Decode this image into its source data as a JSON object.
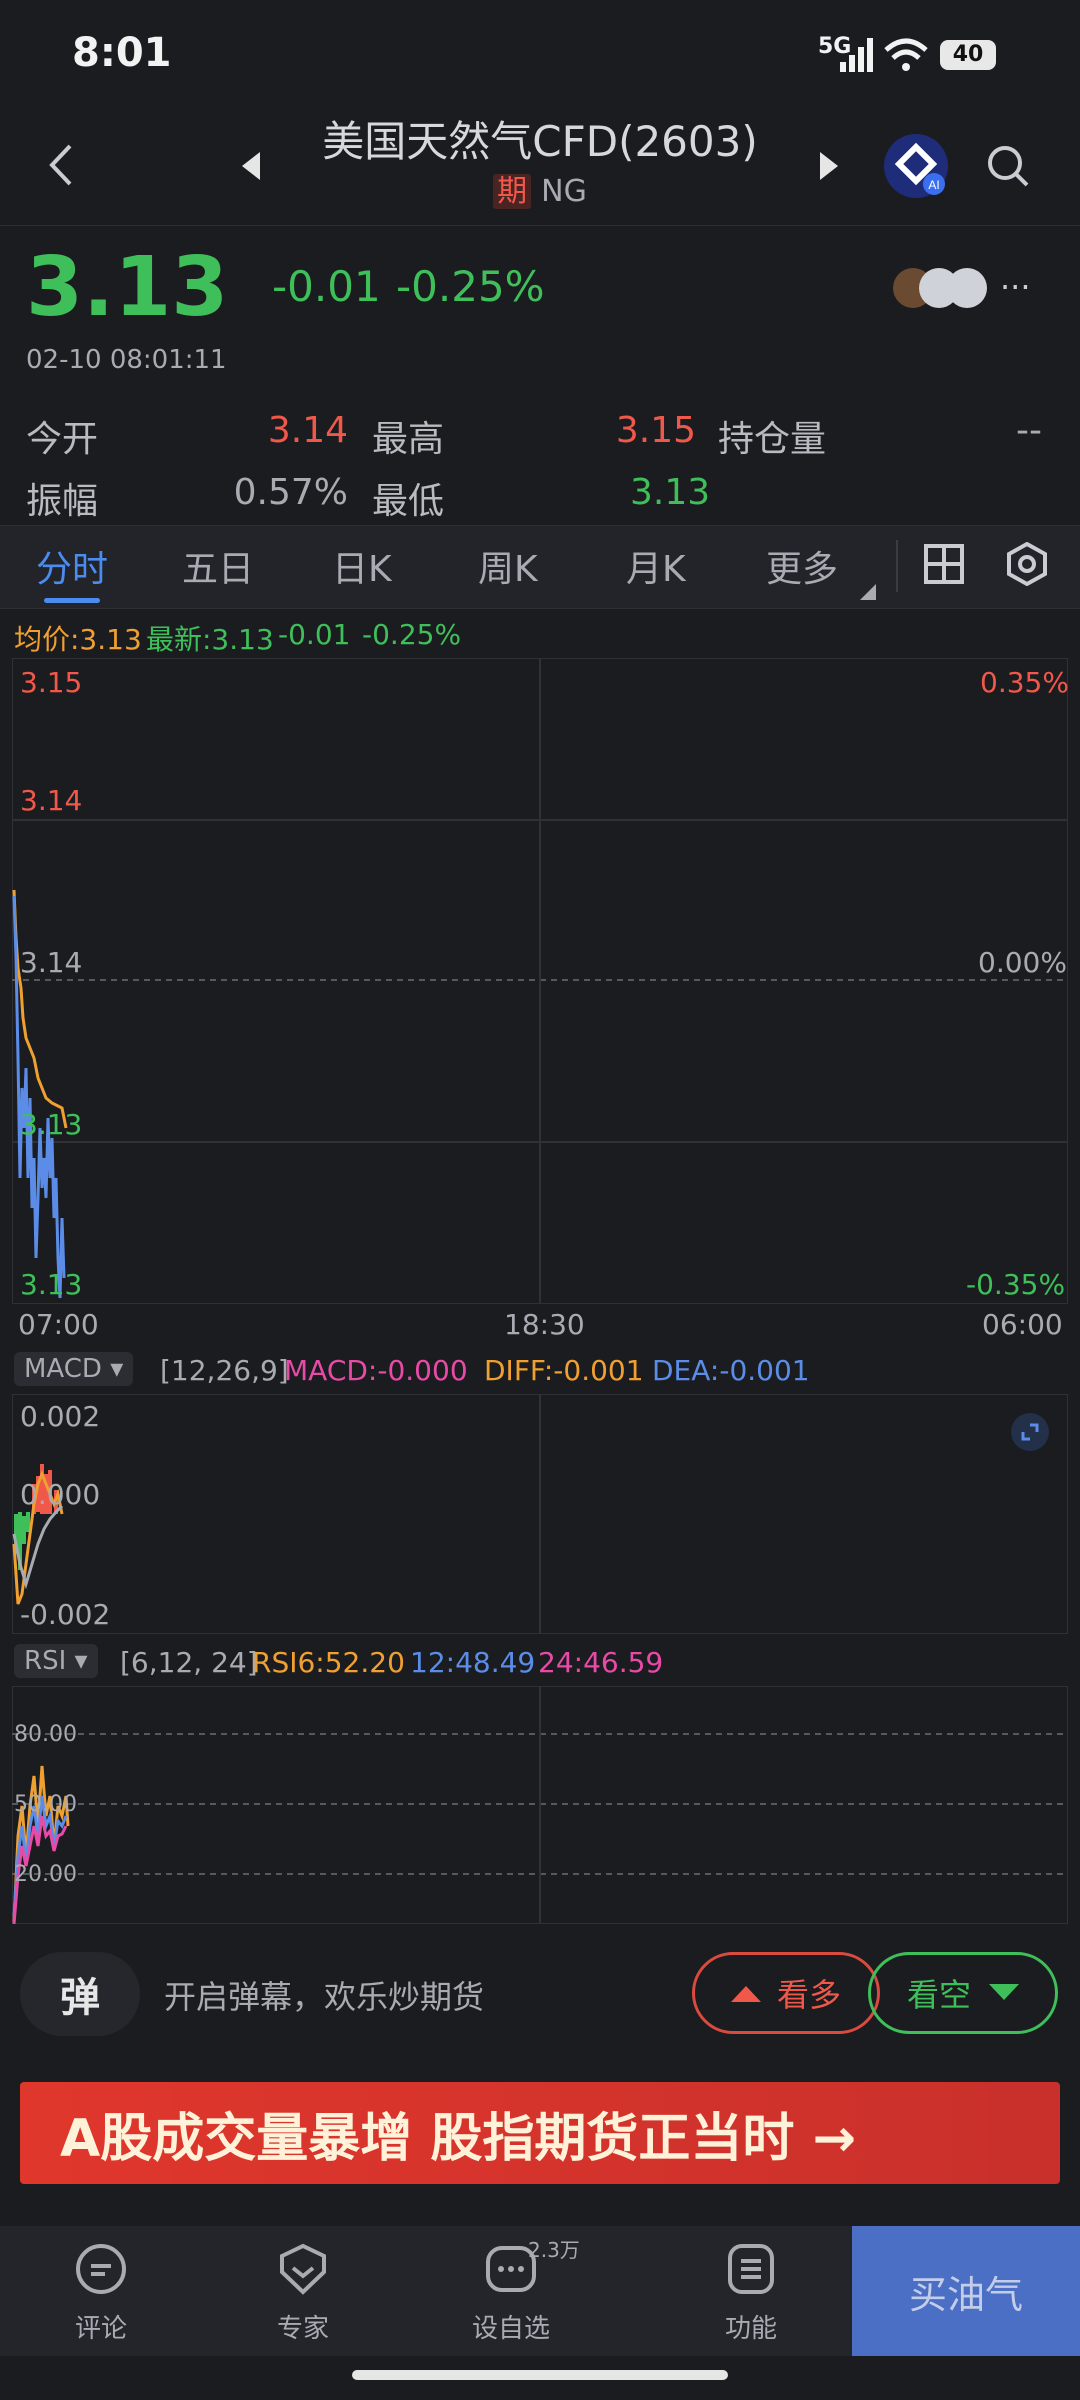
{
  "status": {
    "time": "8:01",
    "network": "5G",
    "battery": "40"
  },
  "header": {
    "title": "美国天然气CFD(2603)",
    "tag": "期",
    "code": "NG"
  },
  "quote": {
    "price": "3.13",
    "change": "-0.01",
    "change_pct": "-0.25%",
    "timestamp": "02-10 08:01:11"
  },
  "stats": {
    "open_label": "今开",
    "open": "3.14",
    "high_label": "最高",
    "high": "3.15",
    "oi_label": "持仓量",
    "oi": "--",
    "amp_label": "振幅",
    "amp": "0.57%",
    "low_label": "最低",
    "low": "3.13"
  },
  "tabs": [
    "分时",
    "五日",
    "日K",
    "周K",
    "月K",
    "更多"
  ],
  "intraday": {
    "avg_label": "均价:3.13",
    "latest_label": "最新:3.13",
    "chg": "-0.01",
    "pct": "-0.25%",
    "y_left": [
      "3.15",
      "3.14",
      "3.14",
      "3.13",
      "3.13"
    ],
    "y_right": [
      "0.35%",
      "0.00%",
      "-0.35%"
    ],
    "x_labels": [
      "07:00",
      "18:30",
      "06:00"
    ]
  },
  "macd": {
    "dropdown": "MACD",
    "params": "[12,26,9]",
    "macd": "MACD:-0.000",
    "diff": "DIFF:-0.001",
    "dea": "DEA:-0.001",
    "y_labels": [
      "0.002",
      "0.000",
      "-0.002"
    ]
  },
  "rsi": {
    "dropdown": "RSI",
    "params": "[6,12, 24]",
    "rsi6": "RSI6:52.20",
    "rsi12": "12:48.49",
    "rsi24": "24:46.59",
    "y_labels": [
      "80.00",
      "50.00",
      "20.00"
    ]
  },
  "danmu": {
    "icon": "弹",
    "text": "开启弹幕，欢乐炒期货"
  },
  "actions": {
    "bull": "看多",
    "bear": "看空"
  },
  "banner": {
    "text": "A股成交量暴增 股指期货正当时 →"
  },
  "bottom_nav": {
    "comment": "评论",
    "expert": "专家",
    "watch": "设自选",
    "watch_count": "2.3万",
    "func": "功能",
    "buy": "买油气"
  },
  "colors": {
    "up": "#f0584a",
    "down": "#3fbf5a",
    "accent": "#4a8cf0",
    "avg": "#f0a030",
    "buy_bg": "#4a6fc4"
  }
}
